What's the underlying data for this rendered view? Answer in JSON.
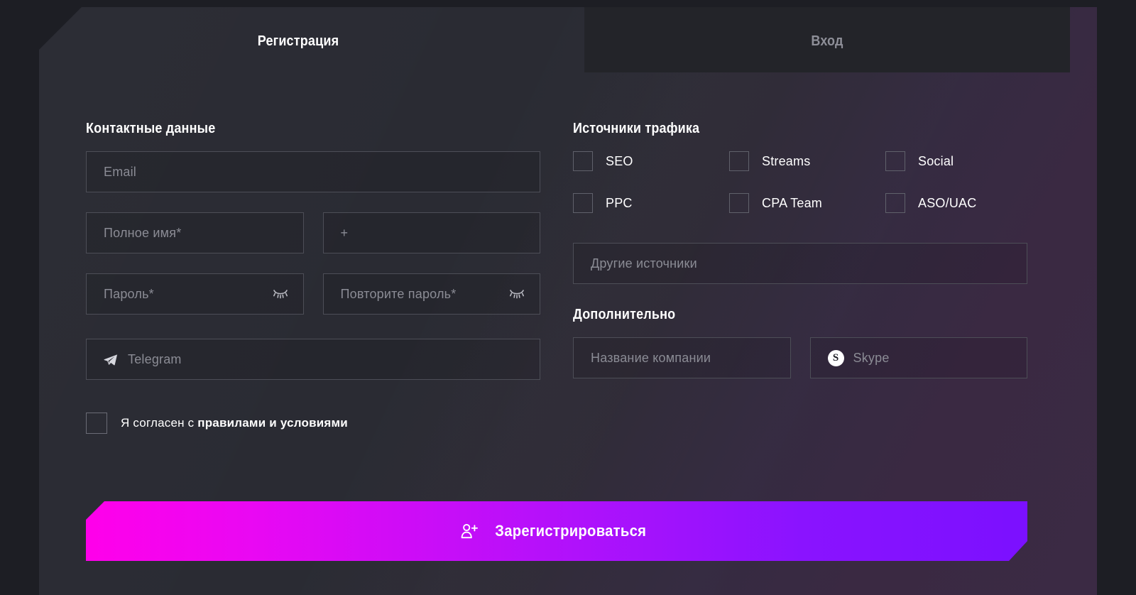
{
  "tabs": [
    {
      "label": "Регистрация",
      "active": true
    },
    {
      "label": "Вход",
      "active": false
    }
  ],
  "left": {
    "section_title": "Контактные данные",
    "email_placeholder": "Email",
    "fullname_placeholder": "Полное имя*",
    "phone_placeholder": "+",
    "password_placeholder": "Пароль*",
    "password_repeat_placeholder": "Повторите пароль*",
    "telegram_placeholder": "Telegram",
    "terms_prefix": "Я согласен с ",
    "terms_link": "правилами и условиями"
  },
  "right": {
    "sources_title": "Источники трафика",
    "sources": [
      {
        "label": "SEO",
        "checked": false
      },
      {
        "label": "Streams",
        "checked": false
      },
      {
        "label": "Social",
        "checked": false
      },
      {
        "label": "PPC",
        "checked": false
      },
      {
        "label": "CPA Team",
        "checked": false
      },
      {
        "label": "ASO/UAC",
        "checked": false
      }
    ],
    "other_sources_placeholder": "Другие источники",
    "additional_title": "Дополнительно",
    "company_placeholder": "Название компании",
    "skype_placeholder": "Skype",
    "skype_logo_letter": "S"
  },
  "submit": {
    "label": "Зарегистрироваться",
    "icon": "user-plus-icon"
  },
  "colors": {
    "page_bg": "#1d1e24",
    "panel_bg_left": "#2a2b33",
    "panel_bg_right": "#3b2a44",
    "tab_inactive_bg": "#232429",
    "field_border": "#4d4e57",
    "placeholder": "#8b8c95",
    "text": "#ffffff",
    "tab_inactive_text": "#8e8f98",
    "gradient_start": "#ff00ea",
    "gradient_end": "#7b10ff"
  }
}
